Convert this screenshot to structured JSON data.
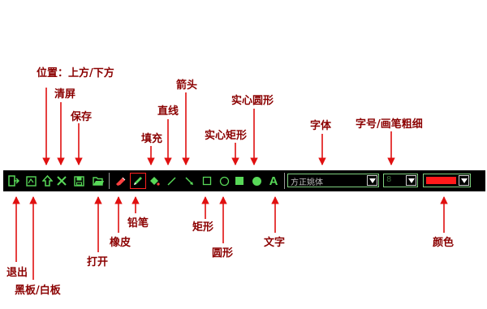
{
  "labels": {
    "position": "位置：上方/下方",
    "clear": "清屏",
    "save": "保存",
    "fill": "填充",
    "line": "直线",
    "arrow": "箭头",
    "filled_rect": "实心矩形",
    "filled_circle": "实心圆形",
    "font": "字体",
    "size": "字号/画笔粗细",
    "exit": "退出",
    "board": "黑板/白板",
    "open": "打开",
    "eraser": "橡皮",
    "pencil": "铅笔",
    "rect": "矩形",
    "circle": "圆形",
    "text": "文字",
    "color": "颜色"
  },
  "toolbar": {
    "font_value": "方正姚体",
    "size_value": "8",
    "color_value": "#ff1a1a",
    "selected_tool": "pencil",
    "text_tool_glyph": "A"
  },
  "colors": {
    "toolbar_bg": "#000000",
    "icon_green": "#58d858",
    "label_color": "#8b0000",
    "arrow_color": "#e01010",
    "selection": "#ff2020"
  },
  "icons": [
    "exit-icon",
    "board-icon",
    "position-icon",
    "clear-icon",
    "save-icon",
    "open-icon",
    "eraser-icon",
    "pencil-icon",
    "fill-icon",
    "line-icon",
    "arrow-icon",
    "rect-icon",
    "circle-icon",
    "filled-rect-icon",
    "filled-circle-icon",
    "text-icon"
  ]
}
